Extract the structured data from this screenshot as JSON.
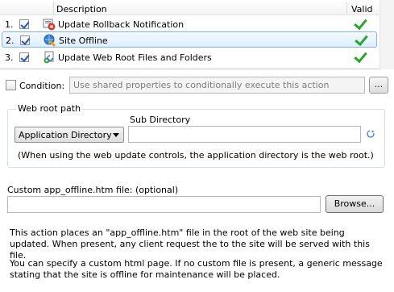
{
  "actions_list": {
    "columns": {
      "description": "Description",
      "valid": "Valid"
    },
    "rows": [
      {
        "number": "1.",
        "checked": true,
        "icon": "rollback-notification-icon",
        "label": "Update Rollback Notification",
        "valid": true,
        "selected": false
      },
      {
        "number": "2.",
        "checked": true,
        "icon": "site-offline-icon",
        "label": "Site Offline",
        "valid": true,
        "selected": true
      },
      {
        "number": "3.",
        "checked": true,
        "icon": "update-files-icon",
        "label": "Update Web Root Files and Folders",
        "valid": true,
        "selected": false
      }
    ]
  },
  "condition": {
    "label": "Condition:",
    "checked": false,
    "placeholder": "Use shared properties to conditionally execute this action",
    "button_label": "..."
  },
  "web_root": {
    "group_title": "Web root path",
    "subdir_label": "Sub Directory",
    "select_value": "Application Directory",
    "subdir_value": "",
    "note": "(When using the web update controls, the application directory is the web root.)"
  },
  "custom_file": {
    "label": "Custom app_offline.htm file: (optional)",
    "value": "",
    "browse_label": "Browse..."
  },
  "description": {
    "paragraph1": "This action places an \"app_offline.htm\" file in the root of the web site being updated. When present, any client request the to the site will be served with this file.",
    "paragraph2": "You can specify a custom html page.  If no custom file is present, a generic message stating that the site is offline for maintenance will be placed."
  },
  "colors": {
    "selection_border": "#7fb4ea",
    "valid_check": "#2aa52a",
    "group_border": "#d5dfe5"
  }
}
